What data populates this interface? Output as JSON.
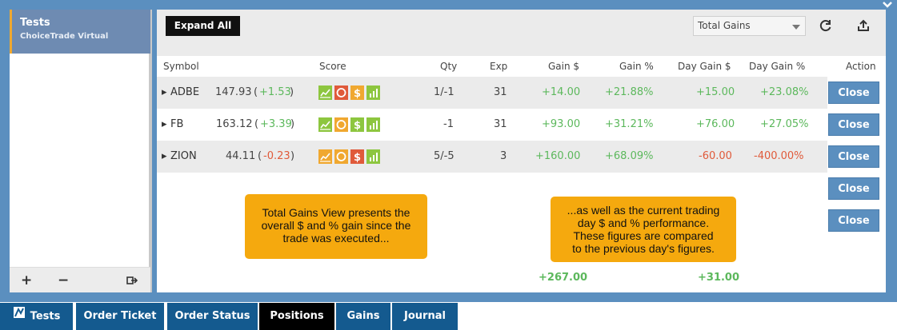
{
  "account": {
    "name": "Tests",
    "type": "ChoiceTrade Virtual"
  },
  "left_footer": {
    "add": "+",
    "remove": "−",
    "export_icon": "export-icon"
  },
  "toolbar": {
    "expand_label": "Expand All",
    "view_selected": "Total Gains",
    "refresh_icon": "refresh-icon",
    "upload_icon": "upload-icon"
  },
  "columns": [
    "Symbol",
    "Score",
    "Qty",
    "Exp",
    "Gain $",
    "Gain %",
    "Day Gain $",
    "Day Gain %",
    "Action"
  ],
  "rows": [
    {
      "symbol": "ADBE",
      "price": "147.93",
      "change": "+1.53",
      "qty": "1/-1",
      "exp": "31",
      "gain": "+14.00",
      "gain_pct": "+21.88%",
      "day_gain": "+15.00",
      "day_gain_pct": "+23.08%",
      "action": "Close",
      "score": [
        "green-chart",
        "red-circle",
        "orange-dollar",
        "green-bars"
      ]
    },
    {
      "symbol": "FB",
      "price": "163.12",
      "change": "+3.39",
      "qty": "-1",
      "exp": "31",
      "gain": "+93.00",
      "gain_pct": "+31.21%",
      "day_gain": "+76.00",
      "day_gain_pct": "+27.05%",
      "action": "Close",
      "score": [
        "green-chart",
        "orange-circle",
        "green-dollar",
        "green-bars"
      ]
    },
    {
      "symbol": "ZION",
      "price": "44.11",
      "change": "-0.23",
      "qty": "5/-5",
      "exp": "3",
      "gain": "+160.00",
      "gain_pct": "+68.09%",
      "day_gain": "-60.00",
      "day_gain_pct": "-400.00%",
      "action": "Close",
      "score": [
        "orange-chart",
        "orange-circle",
        "red-dollar",
        "green-bars"
      ]
    }
  ],
  "extra_actions": [
    "Close",
    "Close"
  ],
  "callouts": {
    "left": [
      "Total Gains View presents the",
      "overall $ and % gain since the",
      "trade was executed..."
    ],
    "right": [
      "...as well as the current trading",
      "day $ and % performance.",
      "These figures are compared",
      "to the previous day's figures."
    ]
  },
  "totals": {
    "gain": "+267.00",
    "day_gain": "+31.00"
  },
  "tabs": [
    {
      "label": "Tests",
      "active": false
    },
    {
      "label": "Order Ticket",
      "active": false
    },
    {
      "label": "Order Status",
      "active": false
    },
    {
      "label": "Positions",
      "active": true
    },
    {
      "label": "Gains",
      "active": false
    },
    {
      "label": "Journal",
      "active": false
    }
  ],
  "colors": {
    "frame": "#5b8fbf",
    "positive": "#5cb85c",
    "negative": "#e05a3a",
    "callout": "#f5a90e",
    "tab": "#145a8f"
  }
}
